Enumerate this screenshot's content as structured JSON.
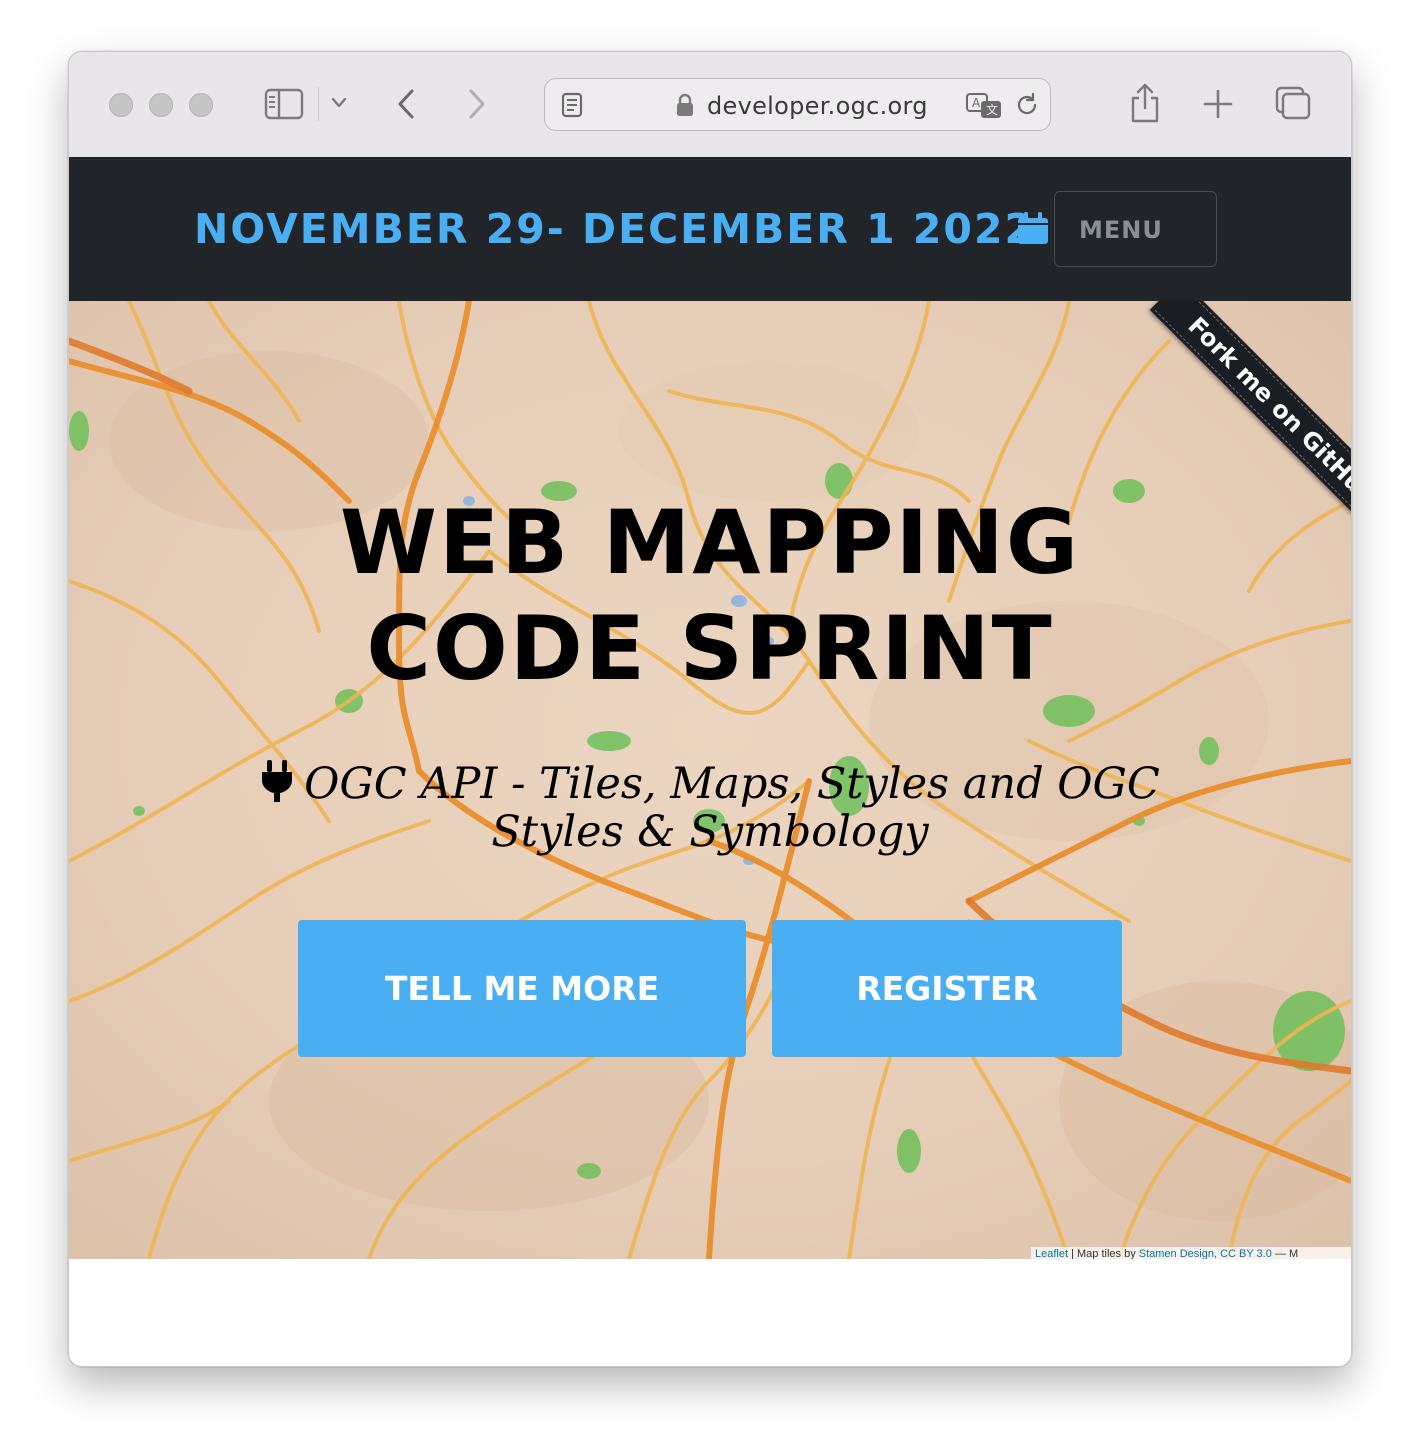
{
  "browser": {
    "url": "developer.ogc.org",
    "icons": [
      "sidebar-icon",
      "chevron-down-icon",
      "back-icon",
      "forward-icon",
      "reader-icon",
      "lock-icon",
      "translate-icon",
      "reload-icon",
      "share-icon",
      "new-tab-icon",
      "tabs-overview-icon"
    ]
  },
  "navbar": {
    "date": "NOVEMBER 29- DECEMBER 1 2022",
    "menu_label": "MENU",
    "ribbon": "Fork me on GitHub",
    "accent_color": "#4aaef2",
    "background": "#212529"
  },
  "hero": {
    "title_line1": "WEB MAPPING",
    "title_line2": "CODE SPRINT",
    "subtitle": "OGC API - Tiles, Maps, Styles and OGC Styles & Symbology",
    "buttons": {
      "tell_more": "TELL ME MORE",
      "register": "REGISTER"
    },
    "attribution": {
      "leaflet": "Leaflet",
      "sep": " | Map tiles by ",
      "stamen": "Stamen Design",
      "license": ", CC BY 3.0",
      "tail": " — M"
    }
  }
}
